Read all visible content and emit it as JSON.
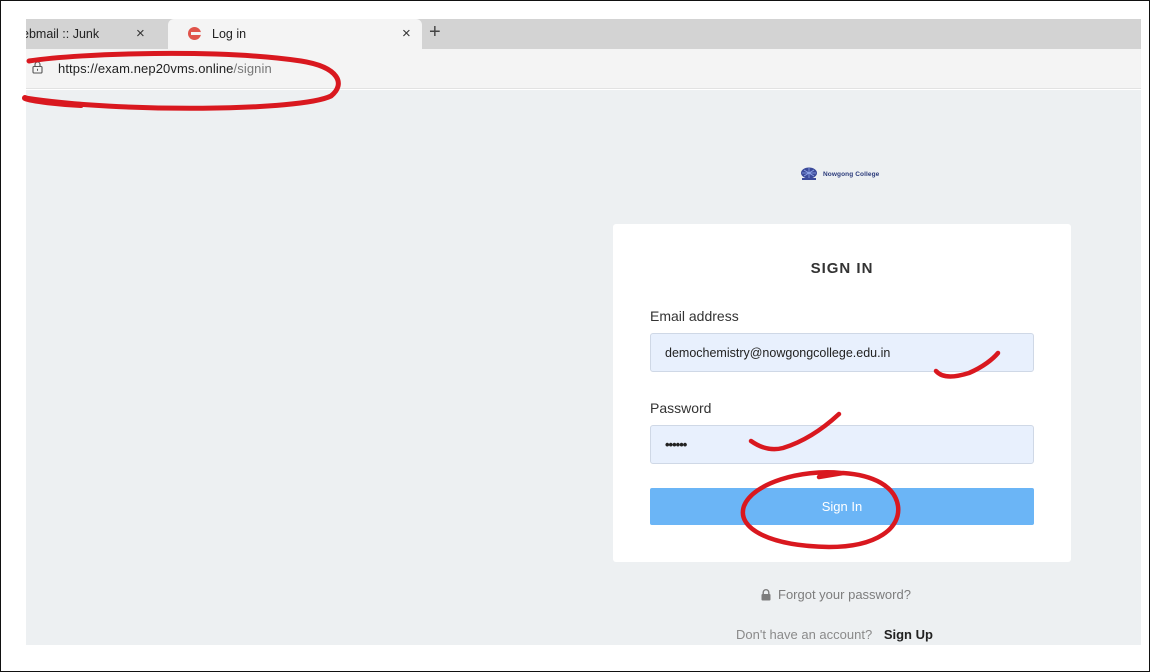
{
  "browser": {
    "tabs": [
      {
        "label": "ebmail :: Junk",
        "active": false
      },
      {
        "label": "Log in",
        "active": true
      }
    ],
    "new_tab": "+",
    "close_glyph": "×",
    "url_host": "https://exam.nep20vms.online",
    "url_path": "/signin"
  },
  "page": {
    "logo_text": "Nowgong College",
    "title": "SIGN IN",
    "email_label": "Email address",
    "email_value": "demochemistry@nowgongcollege.edu.in",
    "password_label": "Password",
    "password_value": "••••••",
    "submit_label": "Sign In",
    "forgot_label": "Forgot your password?",
    "no_account_text": "Don't have an account?",
    "signup_label": "Sign Up"
  },
  "colors": {
    "accent_button": "#6bb5f6",
    "input_bg": "#e8f0fd",
    "page_bg": "#edf0f2",
    "annotation": "#d9181f"
  },
  "icons": [
    "lock-icon",
    "favicon-icon",
    "logo-icon",
    "forgot-lock-icon",
    "close-icon",
    "plus-icon"
  ]
}
